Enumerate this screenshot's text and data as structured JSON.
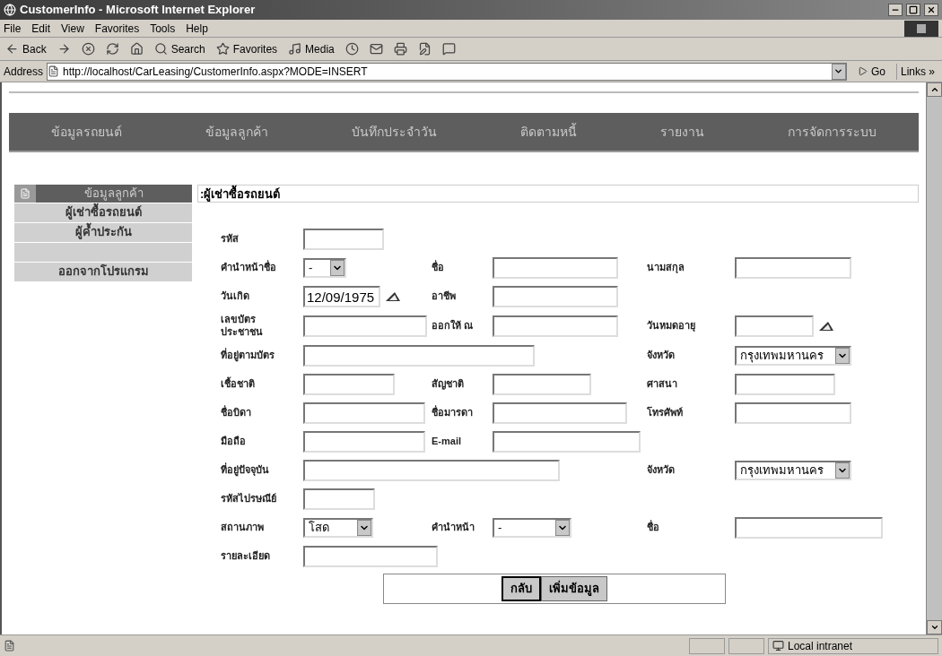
{
  "window": {
    "title": "CustomerInfo - Microsoft Internet Explorer"
  },
  "menu": [
    "File",
    "Edit",
    "View",
    "Favorites",
    "Tools",
    "Help"
  ],
  "toolbar": [
    {
      "kind": "back",
      "label": "Back"
    },
    {
      "kind": "forward"
    },
    {
      "kind": "stop"
    },
    {
      "kind": "refresh"
    },
    {
      "kind": "home"
    },
    {
      "kind": "search",
      "label": "Search"
    },
    {
      "kind": "favorites",
      "label": "Favorites"
    },
    {
      "kind": "media",
      "label": "Media"
    },
    {
      "kind": "history"
    },
    {
      "kind": "mail"
    },
    {
      "kind": "print"
    },
    {
      "kind": "edit"
    },
    {
      "kind": "discuss"
    }
  ],
  "address": {
    "label": "Address",
    "url": "http://localhost/CarLeasing/CustomerInfo.aspx?MODE=INSERT",
    "go": "Go",
    "links": "Links »"
  },
  "nav": [
    "ข้อมูลรถยนต์",
    "ข้อมูลลูกค้า",
    "บันทึกประจำวัน",
    "ติดตามหนี้",
    "รายงาน",
    "การจัดการระบบ"
  ],
  "sidebar": {
    "header": "ข้อมูลลูกค้า",
    "items": [
      {
        "kind": "link",
        "label": "ผู้เช่าซื้อรถยนต์"
      },
      {
        "kind": "link",
        "label": "ผู้ค้ำประกัน"
      },
      {
        "kind": "spacer"
      },
      {
        "kind": "link",
        "label": "ออกจากโปรแกรม"
      }
    ]
  },
  "section_title": ":ผู้เช่าซื้อรถยนต์",
  "form": [
    {
      "fields": [
        {
          "label": "รหัส",
          "kind": "text"
        }
      ]
    },
    {
      "fields": [
        {
          "label": "คำนำหน้าชื่อ",
          "kind": "select",
          "value": "-"
        },
        {
          "label": "ชื่อ",
          "kind": "text"
        },
        {
          "label": "นามสกุล",
          "kind": "text"
        }
      ]
    },
    {
      "fields": [
        {
          "label": "วันเกิด",
          "kind": "date",
          "value": "12/09/1975"
        },
        {
          "label": "อาชีพ",
          "kind": "text"
        }
      ]
    },
    {
      "fields": [
        {
          "label": "เลขบัตร ประชาชน",
          "kind": "text"
        },
        {
          "label": "ออกให้ ณ",
          "kind": "text"
        },
        {
          "label": "วันหมดอายุ",
          "kind": "date"
        }
      ]
    },
    {
      "fields": [
        {
          "label": "ที่อยู่ตามบัตร",
          "kind": "text"
        },
        {
          "label": "จังหวัด",
          "kind": "select",
          "value": "กรุงเทพมหานคร"
        }
      ]
    },
    {
      "fields": [
        {
          "label": "เชื้อชาติ",
          "kind": "text"
        },
        {
          "label": "สัญชาติ",
          "kind": "text"
        },
        {
          "label": "ศาสนา",
          "kind": "text"
        }
      ]
    },
    {
      "fields": [
        {
          "label": "ชื่อบิดา",
          "kind": "text"
        },
        {
          "label": "ชื่อมารดา",
          "kind": "text"
        },
        {
          "label": "โทรศัพท์",
          "kind": "text"
        }
      ]
    },
    {
      "fields": [
        {
          "label": "มือถือ",
          "kind": "text"
        },
        {
          "label": "E-mail",
          "kind": "text"
        }
      ]
    },
    {
      "fields": [
        {
          "label": "ที่อยู่ปัจจุบัน",
          "kind": "text"
        },
        {
          "label": "จังหวัด",
          "kind": "select",
          "value": "กรุงเทพมหานคร"
        }
      ]
    },
    {
      "fields": [
        {
          "label": "รหัสไปรษณีย์",
          "kind": "text"
        }
      ]
    },
    {
      "fields": [
        {
          "label": "สถานภาพ",
          "kind": "select",
          "value": "โสด"
        },
        {
          "label": "คำนำหน้า",
          "kind": "select",
          "value": "-"
        },
        {
          "label": "ชื่อ",
          "kind": "text"
        }
      ]
    },
    {
      "fields": [
        {
          "label": "รายละเอียด",
          "kind": "text"
        }
      ]
    }
  ],
  "buttons": [
    "กลับ",
    "เพิ่มข้อมูล"
  ],
  "status_bar": {
    "zone": "Local intranet"
  }
}
